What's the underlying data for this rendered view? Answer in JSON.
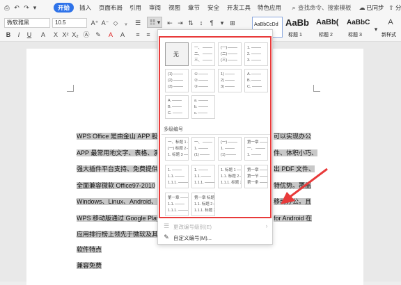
{
  "menubar": {
    "quick_icons": [
      "print-preview-icon",
      "undo-icon",
      "redo-icon",
      "dropdown-icon"
    ],
    "tabs": [
      "开始",
      "插入",
      "页面布局",
      "引用",
      "审阅",
      "视图",
      "章节",
      "安全",
      "开发工具",
      "特色应用"
    ],
    "active_tab": "开始",
    "search_placeholder": "查找命令、搜索模板",
    "sync_status": "已同步",
    "share_label": "分"
  },
  "ribbon": {
    "font_name": "微软雅黑",
    "font_size": "10.5",
    "numbering_tooltip": "编号",
    "styles": [
      {
        "preview": "AaBbCcDd",
        "label": ""
      },
      {
        "preview": "AaBb",
        "label": "标题 1"
      },
      {
        "preview": "AaBb(",
        "label": "标题 2"
      },
      {
        "preview": "AaBbC",
        "label": "标题 3"
      }
    ],
    "new_style_label": "新样式"
  },
  "dropdown": {
    "none_label": "无",
    "multilevel_label": "多级编号",
    "change_level_label": "更改编号级别(E)",
    "custom_label": "自定义编号(M)...",
    "tiles_single": [
      [
        [
          "无"
        ]
      ],
      [
        [
          "一、"
        ],
        [
          "二、"
        ],
        [
          "三、"
        ]
      ],
      [
        [
          "(一)"
        ],
        [
          "(二)"
        ],
        [
          "(三)"
        ]
      ],
      [
        [
          "1."
        ],
        [
          "2."
        ],
        [
          "3."
        ]
      ],
      [
        [
          "(1)"
        ],
        [
          "(2)"
        ],
        [
          "(3)"
        ]
      ],
      [
        [
          "①"
        ],
        [
          "②"
        ],
        [
          "③"
        ]
      ],
      [
        [
          "1)"
        ],
        [
          "2)"
        ],
        [
          "3)"
        ]
      ],
      [
        [
          "A."
        ],
        [
          "B."
        ],
        [
          "C."
        ]
      ],
      [
        [
          "A."
        ],
        [
          "B."
        ],
        [
          "C."
        ]
      ],
      [
        [
          "a."
        ],
        [
          "b."
        ],
        [
          "c."
        ]
      ]
    ],
    "tiles_multi": [
      [
        [
          "一、标题 1"
        ],
        [
          "(一) 标题 2"
        ],
        [
          "1. 标题 3"
        ]
      ],
      [
        [
          "一、"
        ],
        [
          "1."
        ],
        [
          "(1)"
        ]
      ],
      [
        [
          "(一)"
        ],
        [
          "1."
        ],
        [
          "(1)"
        ]
      ],
      [
        [
          "第一章"
        ],
        [
          "一、"
        ],
        [
          "1."
        ]
      ],
      [
        [
          "1."
        ],
        [
          "1.1."
        ],
        [
          "1.1.1."
        ]
      ],
      [
        [
          "1."
        ],
        [
          "1.1."
        ],
        [
          "1.1.1."
        ]
      ],
      [
        [
          "1. 标题 1"
        ],
        [
          "1.1. 标题 2"
        ],
        [
          "1.1.1. 标题 3"
        ]
      ],
      [
        [
          "第一章"
        ],
        [
          "第一节"
        ],
        [
          "第一条"
        ]
      ],
      [
        [
          "第一章"
        ],
        [
          "1.1."
        ],
        [
          "1.1.1."
        ]
      ],
      [
        [
          "第一章 标题 1"
        ],
        [
          "1.1. 标题 2"
        ],
        [
          "1.1.1. 标题 3"
        ]
      ]
    ]
  },
  "document": {
    "lines": [
      {
        "left": "WPS Office 是由金山 APP 股",
        "right": "可以实现办公"
      },
      {
        "left": "APP 最常用地文字、表格、演",
        "right": "件、体积小巧、"
      },
      {
        "left": "强大插件平台支持、免费提供",
        "right": "出 PDF 文件、"
      },
      {
        "left": "全面兼容微软 Office97-2010",
        "right": "特优势。覆盖"
      },
      {
        "left": "Windows、Linux、Android、",
        "right": "移动办公。且"
      },
      {
        "left": "WPS 移动版通过 Google Play",
        "right": "for Android 在"
      },
      {
        "left": "应用排行榜上领先于微软及其",
        "right": ""
      },
      {
        "left": "软件特点",
        "right": ""
      },
      {
        "left": "兼容免费",
        "right": ""
      }
    ]
  },
  "colors": {
    "accent": "#2f73e9",
    "highlight_box": "#e83a3a",
    "text_highlight": "#c8c8c8"
  }
}
